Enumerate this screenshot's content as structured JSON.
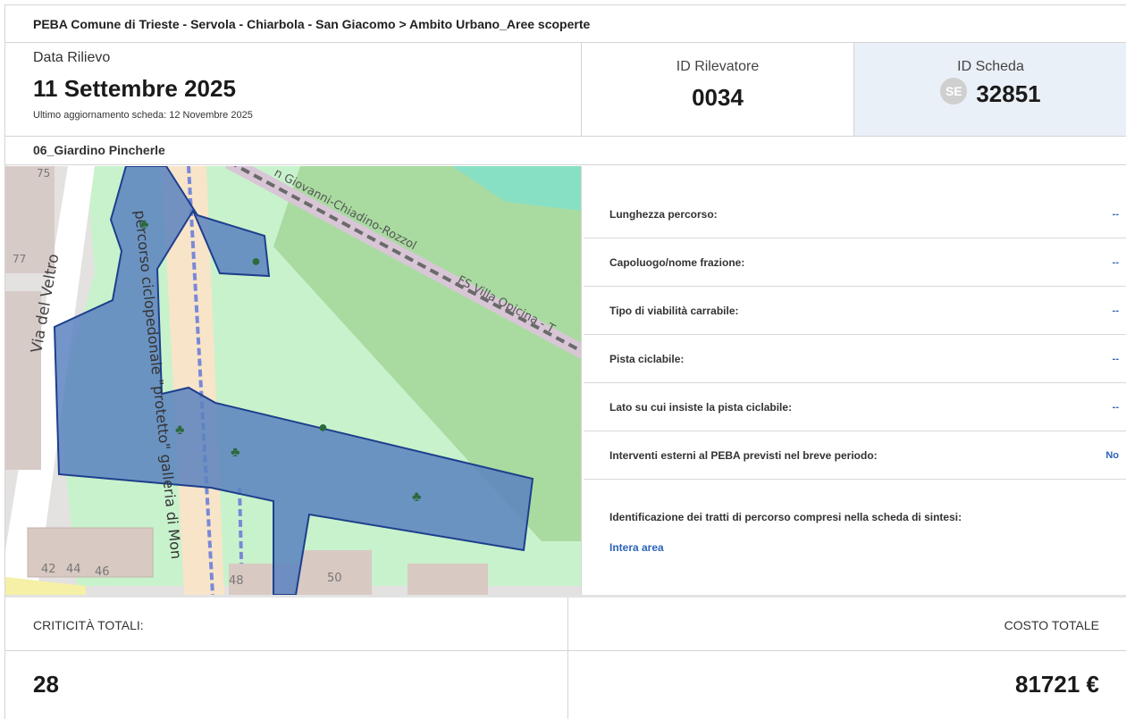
{
  "breadcrumb": "PEBA Comune di Trieste - Servola - Chiarbola - San Giacomo > Ambito Urbano_Aree scoperte",
  "survey": {
    "date_label": "Data Rilievo",
    "date": "11 Settembre 2025",
    "updated": "Ultimo aggiornamento scheda: 12 Novembre 2025"
  },
  "surveyor": {
    "label": "ID Rilevatore",
    "value": "0034"
  },
  "sheet": {
    "label": "ID Scheda",
    "badge": "SE",
    "value": "32851"
  },
  "section_title": "06_Giardino Pincherle",
  "map": {
    "labels": {
      "street_veltro": "Via del Veltro",
      "path_label": "percorso ciclopedonale \"protetto\" galleria di Mon",
      "rail_label": "n Giovanni-Chiadino-Rozzol",
      "rail_label2": "FS Villa Opicina - T",
      "n75": "75",
      "n77": "77",
      "n42": "42",
      "n44": "44",
      "n46": "46",
      "n48": "48",
      "n50": "50"
    },
    "colors": {
      "park": "#c8f2cc",
      "forest": "#a9dba1",
      "water": "#88e0c4",
      "area": "#5a82bf",
      "area_border": "#1d3f8c"
    }
  },
  "properties": [
    {
      "label": "Lunghezza percorso:",
      "value": "--"
    },
    {
      "label": "Capoluogo/nome frazione:",
      "value": "--"
    },
    {
      "label": "Tipo di viabilità carrabile:",
      "value": "--"
    },
    {
      "label": "Pista ciclabile:",
      "value": "--"
    },
    {
      "label": "Lato su cui insiste la pista ciclabile:",
      "value": "--"
    },
    {
      "label": "Interventi esterni al PEBA previsti nel breve periodo:",
      "value": "No"
    }
  ],
  "identification": {
    "label": "Identificazione dei tratti di percorso compresi nella scheda di sintesi:",
    "link": "Intera area"
  },
  "totals": {
    "criticita_label": "CRITICITÀ TOTALI:",
    "criticita_value": "28",
    "costo_label": "COSTO TOTALE",
    "costo_value": "81721 €"
  }
}
